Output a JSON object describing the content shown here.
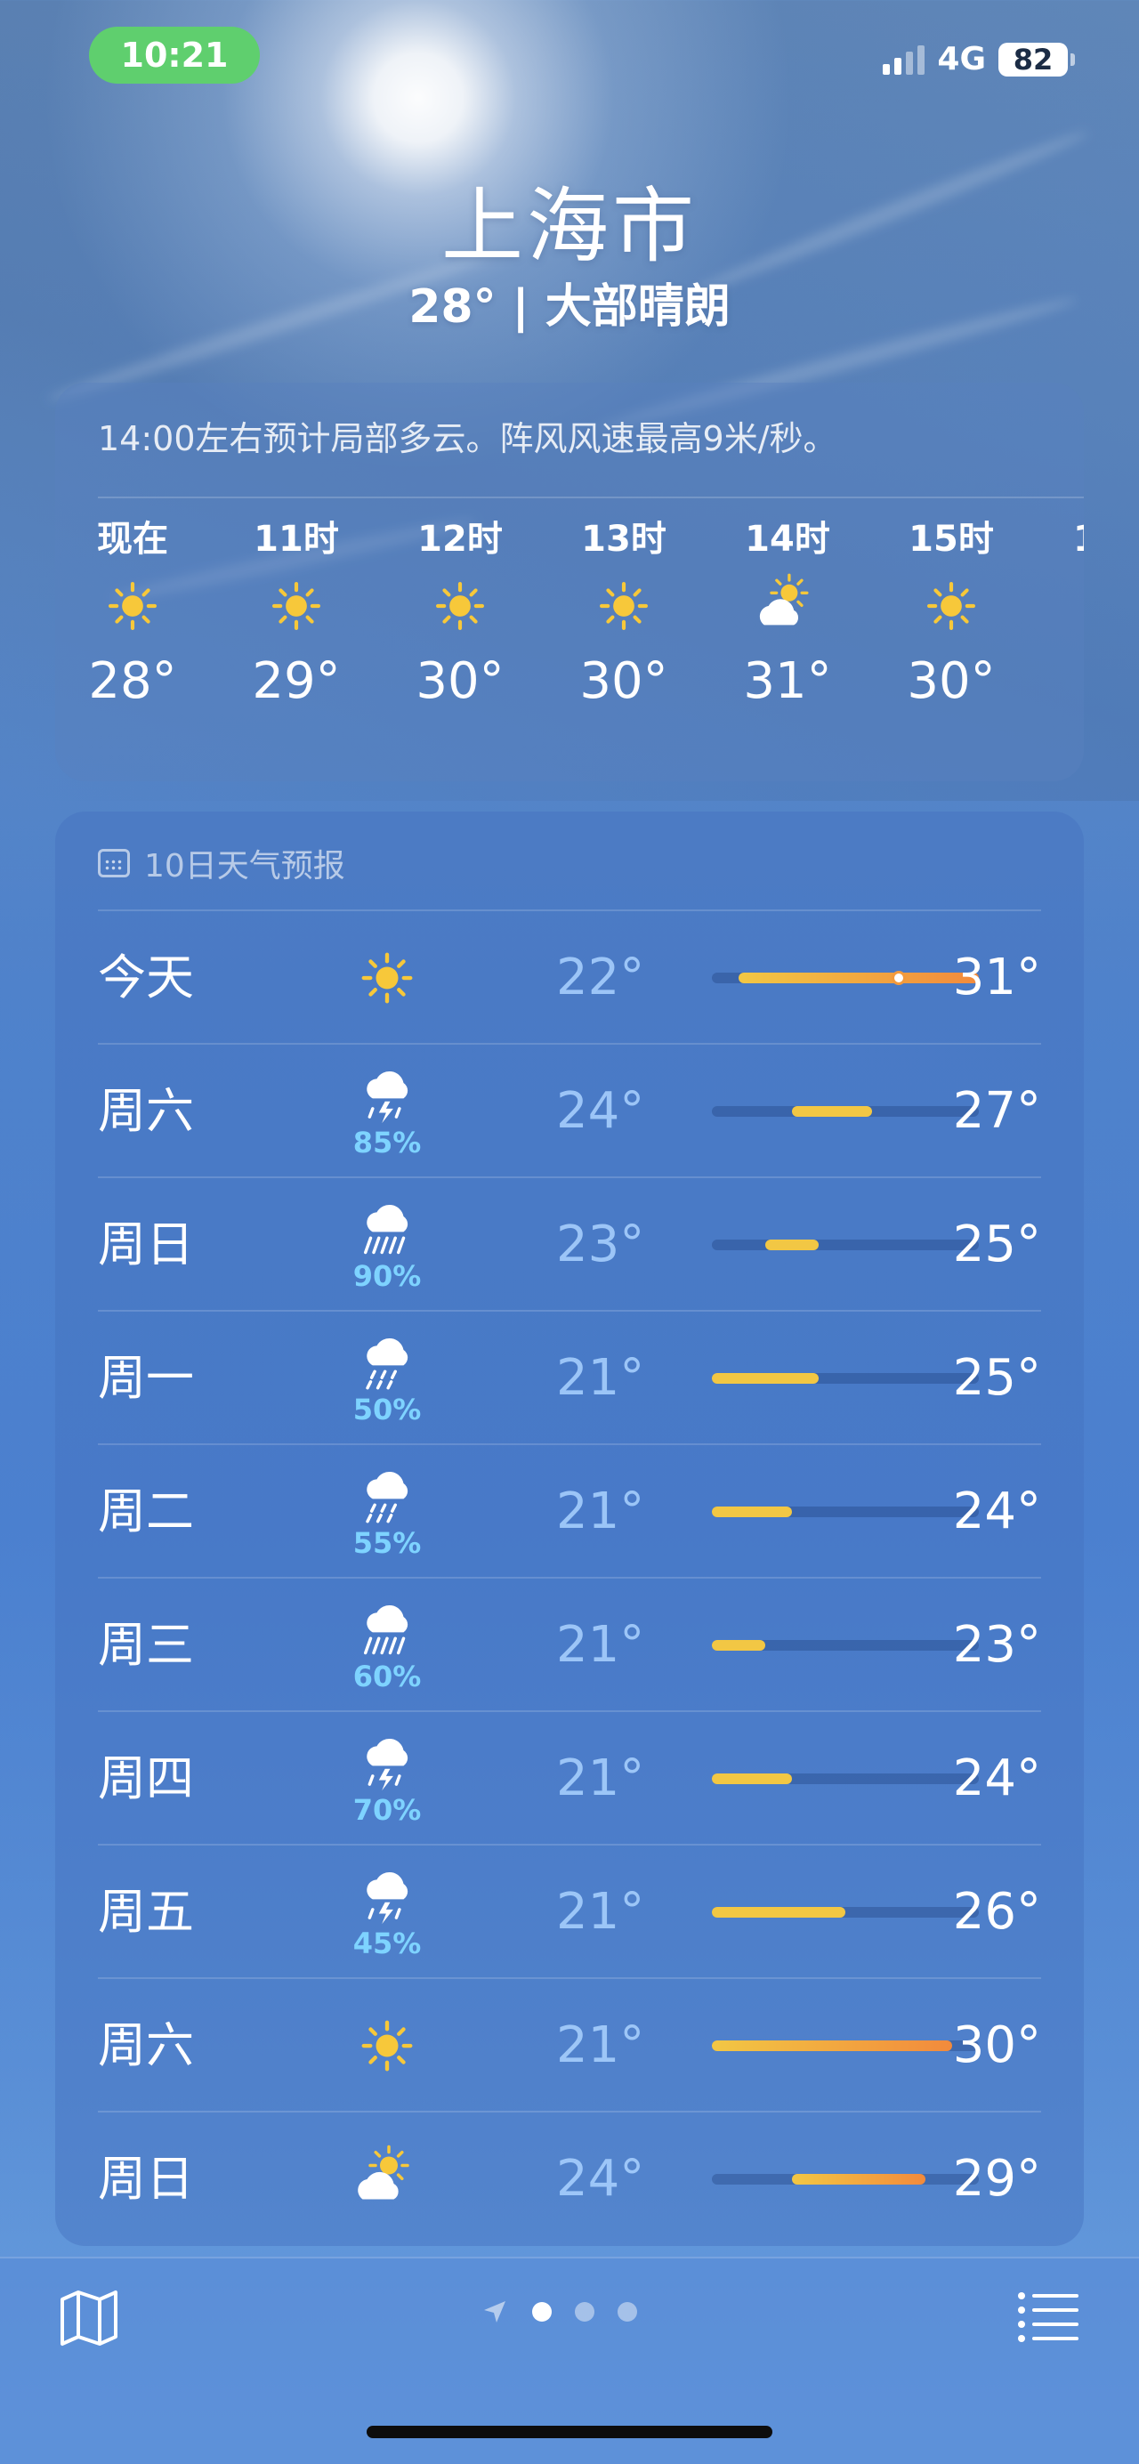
{
  "status_bar": {
    "time": "10:21",
    "network": "4G",
    "battery": "82"
  },
  "header": {
    "city": "上海市",
    "summary": "28° | 大部晴朗"
  },
  "hourly": {
    "note": "14:00左右预计局部多云。阵风风速最高9米/秒。",
    "items": [
      {
        "label": "现在",
        "icon": "sun-icon",
        "temp": "28°"
      },
      {
        "label": "11时",
        "icon": "sun-icon",
        "temp": "29°"
      },
      {
        "label": "12时",
        "icon": "sun-icon",
        "temp": "30°"
      },
      {
        "label": "13时",
        "icon": "sun-icon",
        "temp": "30°"
      },
      {
        "label": "14时",
        "icon": "partly-cloudy-icon",
        "temp": "31°"
      },
      {
        "label": "15时",
        "icon": "sun-icon",
        "temp": "30°"
      }
    ]
  },
  "daily": {
    "title": "10日天气预报",
    "range": {
      "min": 21,
      "max": 31
    },
    "current_temp": 28,
    "items": [
      {
        "day": "今天",
        "icon": "sun-icon",
        "precip": "",
        "low": "22°",
        "high": "31°",
        "lo": 22,
        "hi": 31,
        "current": true
      },
      {
        "day": "周六",
        "icon": "thunderstorm-icon",
        "precip": "85%",
        "low": "24°",
        "high": "27°",
        "lo": 24,
        "hi": 27
      },
      {
        "day": "周日",
        "icon": "heavy-rain-icon",
        "precip": "90%",
        "low": "23°",
        "high": "25°",
        "lo": 23,
        "hi": 25
      },
      {
        "day": "周一",
        "icon": "rain-icon",
        "precip": "50%",
        "low": "21°",
        "high": "25°",
        "lo": 21,
        "hi": 25
      },
      {
        "day": "周二",
        "icon": "rain-icon",
        "precip": "55%",
        "low": "21°",
        "high": "24°",
        "lo": 21,
        "hi": 24
      },
      {
        "day": "周三",
        "icon": "heavy-rain-icon",
        "precip": "60%",
        "low": "21°",
        "high": "23°",
        "lo": 21,
        "hi": 23
      },
      {
        "day": "周四",
        "icon": "thunderstorm-icon",
        "precip": "70%",
        "low": "21°",
        "high": "24°",
        "lo": 21,
        "hi": 24
      },
      {
        "day": "周五",
        "icon": "thunderstorm-icon",
        "precip": "45%",
        "low": "21°",
        "high": "26°",
        "lo": 21,
        "hi": 26
      },
      {
        "day": "周六",
        "icon": "sun-icon",
        "precip": "",
        "low": "21°",
        "high": "30°",
        "lo": 21,
        "hi": 30
      },
      {
        "day": "周日",
        "icon": "partly-cloudy-icon",
        "precip": "",
        "low": "24°",
        "high": "29°",
        "lo": 24,
        "hi": 29
      }
    ]
  },
  "bottom_bar": {
    "map_icon": "map-icon",
    "list_icon": "list-icon",
    "location_icon": "location-arrow-icon",
    "pages": 3,
    "active_page": 0
  },
  "colors": {
    "status_pill": "#5fcf6e",
    "sun": "#f7c83a",
    "precip": "#7ed3ff",
    "bar_cool": "#f2c744",
    "bar_warm": "#f28a3c"
  }
}
